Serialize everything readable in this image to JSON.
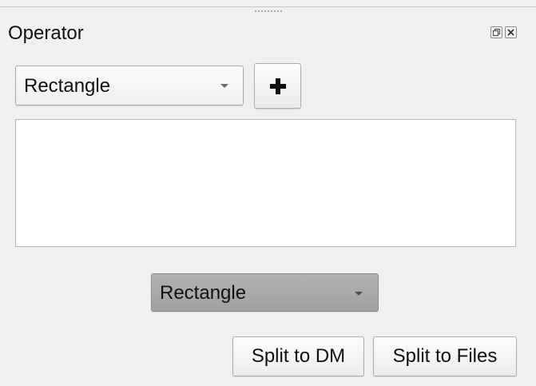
{
  "panel": {
    "title": "Operator",
    "float_icon": "float-window-icon",
    "close_icon": "close-icon"
  },
  "operator_select": {
    "selected": "Rectangle",
    "arrow_icon": "chevron-down-icon"
  },
  "add_button": {
    "icon": "plus-icon"
  },
  "operator_list": {
    "items": []
  },
  "shape_select": {
    "selected": "Rectangle",
    "arrow_icon": "chevron-down-icon"
  },
  "actions": {
    "split_dm_label": "Split to DM",
    "split_files_label": "Split to Files"
  },
  "colors": {
    "panel_bg": "#f0f0f0",
    "list_bg": "#ffffff",
    "shape_select_bg": "#a8a8a8"
  }
}
